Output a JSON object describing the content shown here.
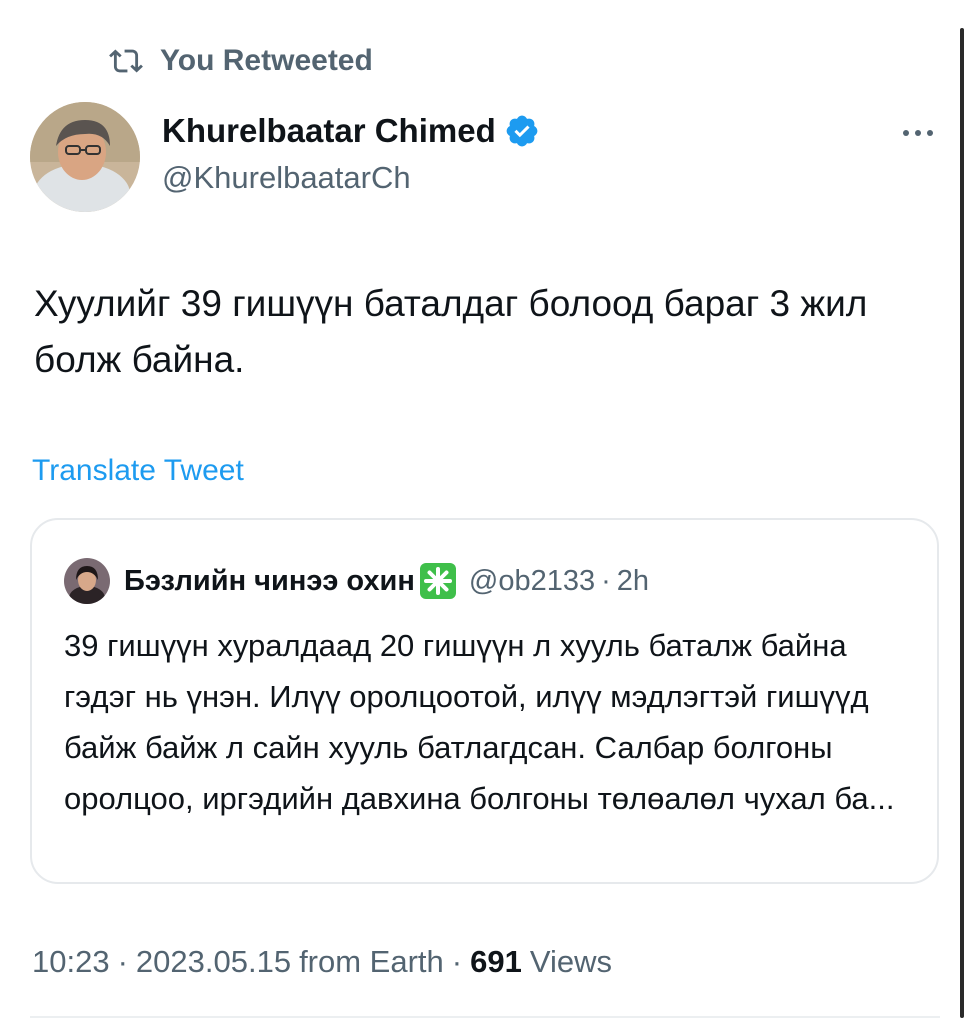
{
  "retweet": {
    "icon": "retweet-icon",
    "label": "You Retweeted"
  },
  "author": {
    "name": "Khurelbaatar Chimed",
    "handle": "@KhurelbaatarCh",
    "verified_color": "#1d9bf0"
  },
  "tweet": {
    "text": "Хуулийг 39 гишүүн баталдаг болоод бараг 3 жил болж байна.",
    "translate_label": "Translate Tweet"
  },
  "quote": {
    "name": "Бэзлийн чинээ охин",
    "emoji_icon": "sparkle-emoji-icon",
    "handle": "@ob2133",
    "separator": "·",
    "time": "2h",
    "text": "39 гишүүн хуралдаад 20 гишүүн л хууль баталж байна гэдэг нь үнэн. Илүү оролцоотой, илүү мэдлэгтэй гишүүд байж байж л сайн хууль батлагдсан. Салбар болгоны оролцоо, иргэдийн давхина болгоны төлөалөл чухал ба..."
  },
  "meta": {
    "time": "10:23",
    "date": "2023.05.15",
    "source": "from Earth",
    "separator": "·",
    "views_count": "691",
    "views_label": "Views"
  },
  "colors": {
    "accent": "#1d9bf0",
    "secondary_text": "#536471",
    "primary_text": "#0f1419",
    "emoji_bg": "#3fbf4a"
  }
}
